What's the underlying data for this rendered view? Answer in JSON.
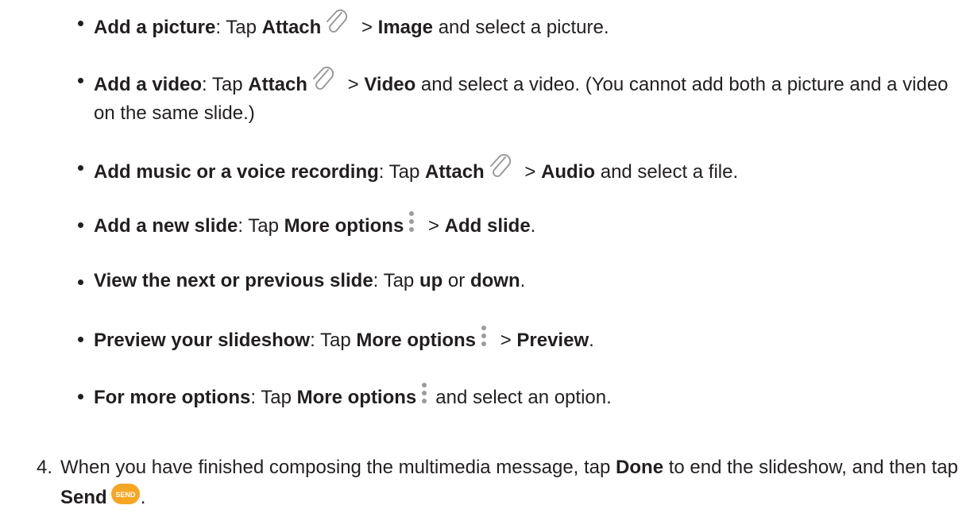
{
  "bullets": [
    {
      "term": "Add a picture",
      "sep": ": Tap ",
      "action": "Attach",
      "arrow": " > ",
      "target": "Image",
      "tail": " and select a picture.",
      "icon": "paperclip-icon"
    },
    {
      "term": "Add a video",
      "sep": ": Tap ",
      "action": "Attach",
      "arrow": " > ",
      "target": "Video",
      "tail": " and select a video. (You cannot add both a picture and a video on the same slide.)",
      "icon": "paperclip-icon"
    },
    {
      "term": "Add music or a voice recording",
      "sep": ": Tap ",
      "action": "Attach",
      "arrow": " > ",
      "target": "Audio",
      "tail": " and select a file.",
      "icon": "paperclip-icon"
    },
    {
      "term": "Add a new slide",
      "sep": ": Tap ",
      "action": "More options",
      "arrow": " > ",
      "target": "Add slide",
      "tail": ".",
      "icon": "more-options-icon"
    },
    {
      "term": "View the next or previous slide",
      "sep": ": Tap ",
      "up": "up",
      "or": " or ",
      "down": "down",
      "tail": "."
    },
    {
      "term": "Preview your slideshow",
      "sep": ": Tap ",
      "action": "More options",
      "arrow": " > ",
      "target": "Preview",
      "tail": ".",
      "icon": "more-options-icon"
    },
    {
      "term": "For more options",
      "sep": ": Tap ",
      "action": "More options",
      "tail": "and select an option.",
      "icon": "more-options-icon"
    }
  ],
  "step": {
    "number": "4.",
    "text_before": "When you have finished composing the multimedia message, tap ",
    "done": "Done",
    "text_middle": " to end the slideshow, and then tap ",
    "send": "Send",
    "text_after": ".",
    "send_icon_label": "SEND",
    "send_icon_color": "#f6a623"
  },
  "colors": {
    "text": "#231f20",
    "icon_gray": "#9b9b9b"
  }
}
